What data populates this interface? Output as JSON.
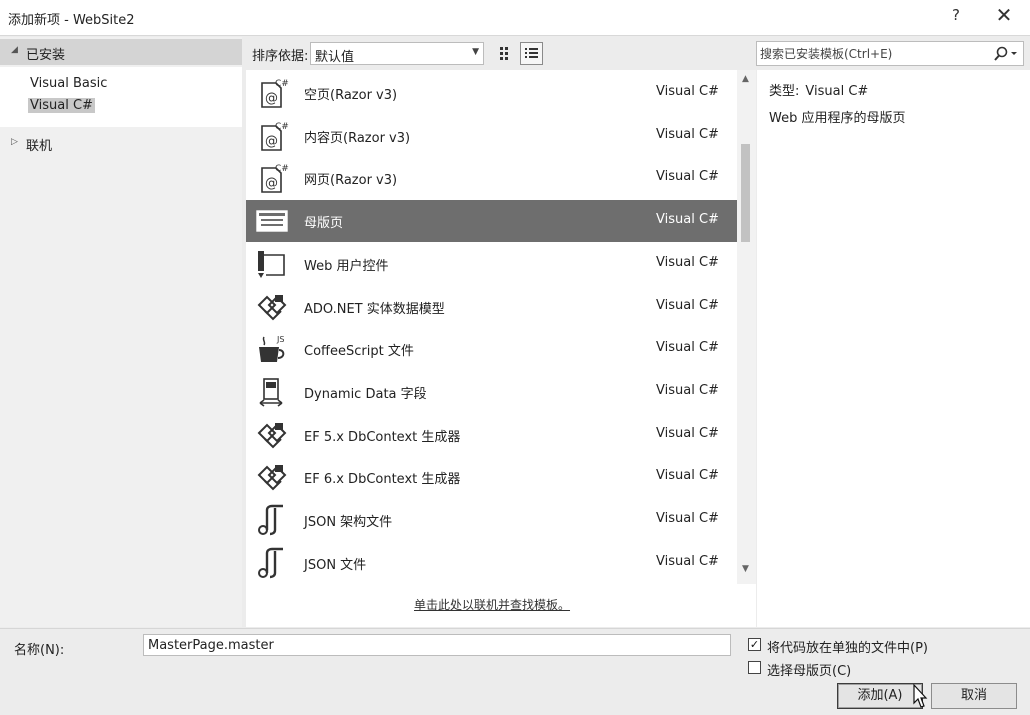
{
  "window": {
    "title": "添加新项 - WebSite2",
    "help_label": "?",
    "close_label": "✕"
  },
  "sidebar": {
    "installed_label": "已安装",
    "items": [
      {
        "label": "Visual Basic",
        "selected": false
      },
      {
        "label": "Visual C#",
        "selected": true
      }
    ],
    "online_label": "联机"
  },
  "toolbar": {
    "sort_label": "排序依据:",
    "sort_value": "默认值",
    "view_modes": [
      "grid-view-icon",
      "list-view-icon"
    ],
    "active_view": "list-view-icon"
  },
  "search": {
    "placeholder": "搜索已安装模板(Ctrl+E)",
    "value": ""
  },
  "templates": [
    {
      "name": "空页(Razor v3)",
      "lang": "Visual C#",
      "icon": "razor-page-icon",
      "selected": false
    },
    {
      "name": "内容页(Razor v3)",
      "lang": "Visual C#",
      "icon": "razor-page-icon",
      "selected": false
    },
    {
      "name": "网页(Razor v3)",
      "lang": "Visual C#",
      "icon": "razor-page-icon",
      "selected": false
    },
    {
      "name": "母版页",
      "lang": "Visual C#",
      "icon": "master-page-icon",
      "selected": true
    },
    {
      "name": "Web 用户控件",
      "lang": "Visual C#",
      "icon": "user-control-icon",
      "selected": false
    },
    {
      "name": "ADO.NET 实体数据模型",
      "lang": "Visual C#",
      "icon": "data-model-icon",
      "selected": false
    },
    {
      "name": "CoffeeScript 文件",
      "lang": "Visual C#",
      "icon": "coffeescript-icon",
      "selected": false
    },
    {
      "name": "Dynamic Data 字段",
      "lang": "Visual C#",
      "icon": "dynamic-data-icon",
      "selected": false
    },
    {
      "name": "EF 5.x DbContext 生成器",
      "lang": "Visual C#",
      "icon": "data-model-icon",
      "selected": false
    },
    {
      "name": "EF 6.x DbContext 生成器",
      "lang": "Visual C#",
      "icon": "data-model-icon",
      "selected": false
    },
    {
      "name": "JSON 架构文件",
      "lang": "Visual C#",
      "icon": "json-file-icon",
      "selected": false
    },
    {
      "name": "JSON 文件",
      "lang": "Visual C#",
      "icon": "json-file-icon",
      "selected": false
    }
  ],
  "online_link": "单击此处以联机并查找模板。",
  "details": {
    "type_key": "类型:",
    "type_value": "Visual C#",
    "description": "Web 应用程序的母版页"
  },
  "form": {
    "name_label": "名称(N):",
    "name_value": "MasterPage.master",
    "checkbox_separate": {
      "label": "将代码放在单独的文件中(P)",
      "checked": true
    },
    "checkbox_master": {
      "label": "选择母版页(C)",
      "checked": false
    },
    "add_button": "添加(A)",
    "cancel_button": "取消"
  }
}
